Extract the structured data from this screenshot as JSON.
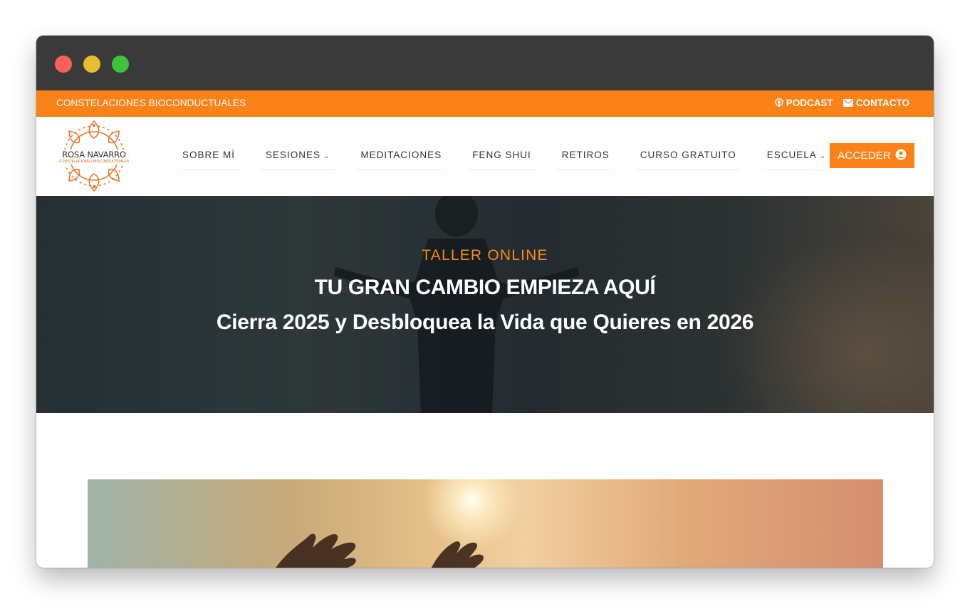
{
  "topbar": {
    "tagline": "CONSTELACIONES BIOCONDUCTUALES",
    "podcast_label": "PODCAST",
    "contact_label": "CONTACTO",
    "accent_color": "#fb8119"
  },
  "logo": {
    "name": "ROSA NAVARRO",
    "subtitle": "CONSTELACIONES BIOCONDUCTUALES"
  },
  "nav": {
    "items": [
      {
        "label": "SOBRE MÍ",
        "has_dropdown": false
      },
      {
        "label": "SESIONES",
        "has_dropdown": true
      },
      {
        "label": "MEDITACIONES",
        "has_dropdown": false
      },
      {
        "label": "FENG SHUI",
        "has_dropdown": false
      },
      {
        "label": "RETIROS",
        "has_dropdown": false
      },
      {
        "label": "CURSO GRATUITO",
        "has_dropdown": false
      },
      {
        "label": "ESCUELA",
        "has_dropdown": true
      }
    ],
    "cta_label": "ACCEDER"
  },
  "hero": {
    "kicker": "TALLER ONLINE",
    "title": "TU GRAN CAMBIO EMPIEZA AQUÍ",
    "subtitle": "Cierra 2025 y Desbloquea la Vida que Quieres en 2026",
    "kicker_color": "#f58a1f"
  }
}
